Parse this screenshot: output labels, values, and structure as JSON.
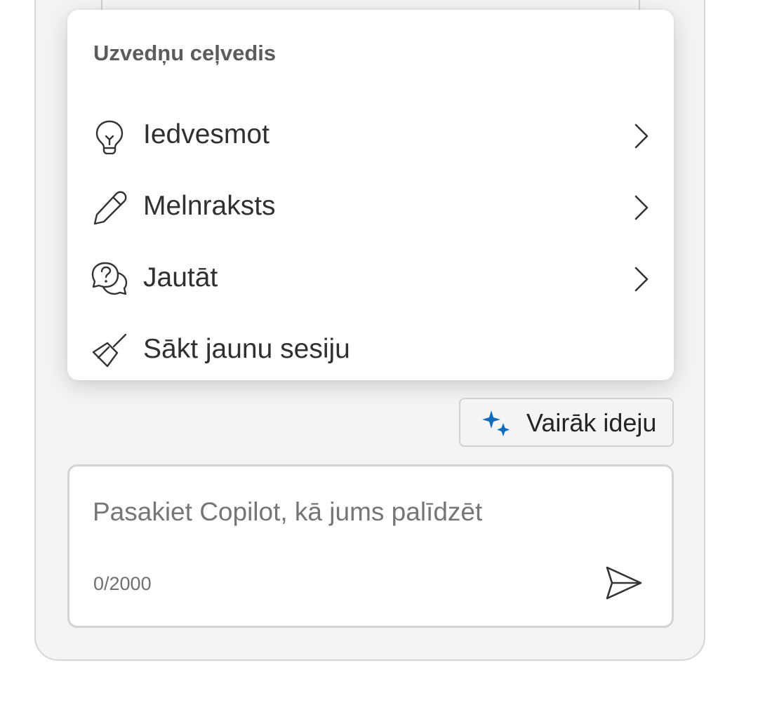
{
  "menu": {
    "title": "Uzvedņu ceļvedis",
    "items": [
      {
        "label": "Iedvesmot",
        "icon": "lightbulb-icon",
        "has_submenu": true
      },
      {
        "label": "Melnraksts",
        "icon": "pencil-icon",
        "has_submenu": true
      },
      {
        "label": "Jautāt",
        "icon": "chat-question-icon",
        "has_submenu": true
      },
      {
        "label": "Sākt jaunu sesiju",
        "icon": "broom-icon",
        "has_submenu": false
      }
    ]
  },
  "more_ideas": {
    "label": "Vairāk ideju",
    "icon": "sparkle-icon",
    "icon_color": "#0f6cbd"
  },
  "composer": {
    "placeholder": "Pasakiet Copilot, kā jums palīdzēt",
    "value": "",
    "counter": "0/2000",
    "send_icon": "send-icon"
  },
  "colors": {
    "panel_background": "#f4f4f4",
    "accent": "#0f6cbd"
  }
}
